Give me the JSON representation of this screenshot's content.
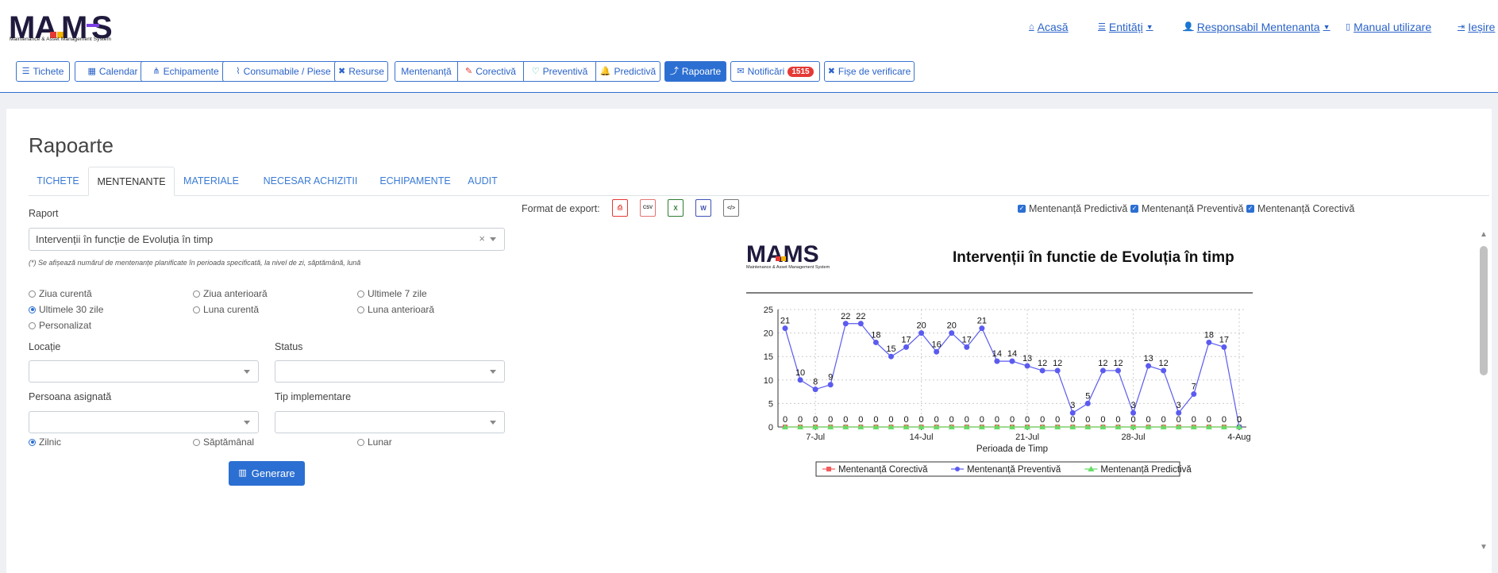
{
  "brand": {
    "logo_text": "MAMS",
    "subtitle": "Maintenance & Asset Management System"
  },
  "topnav": {
    "home": "Acasă",
    "entities": "Entități",
    "user": "Responsabil Mentenanta",
    "manual": "Manual utilizare",
    "logout": "Ieșire"
  },
  "toolbar": {
    "tickets": "Tichete",
    "calendar": "Calendar",
    "equipment": "Echipamente",
    "consumables": "Consumabile / Piese",
    "resources": "Resurse",
    "maintenance": "Mentenanță",
    "corrective": "Corectivă",
    "preventive": "Preventivă",
    "predictive": "Predictivă",
    "reports": "Rapoarte",
    "notifications": "Notificări",
    "notifications_count": "1515",
    "checklists": "Fișe de verificare"
  },
  "page": {
    "title": "Rapoarte",
    "tabs": [
      "TICHETE",
      "MENTENANTE",
      "MATERIALE",
      "NECESAR ACHIZITII",
      "ECHIPAMENTE",
      "AUDIT"
    ],
    "active_tab": "MENTENANTE"
  },
  "form": {
    "report_label": "Raport",
    "report_value": "Intervenții în funcție de Evoluția în timp",
    "report_clear": "×",
    "note": "(*) Se afișează numărul de mentenanțe planificate în perioada specificată, la nivel de zi, săptămână, lună",
    "periods": [
      "Ziua curentă",
      "Ziua anterioară",
      "Ultimele 7 zile",
      "Ultimele 30 zile",
      "Luna curentă",
      "Luna anterioară",
      "Personalizat"
    ],
    "period_selected": "Ultimele 30 zile",
    "location_label": "Locație",
    "status_label": "Status",
    "assignee_label": "Persoana asignată",
    "impl_label": "Tip implementare",
    "granularity": [
      "Zilnic",
      "Săptămânal",
      "Lunar"
    ],
    "granularity_selected": "Zilnic",
    "generate": "Generare"
  },
  "export": {
    "label": "Format de export:",
    "formats": [
      "pdf-icon",
      "csv-icon",
      "excel-icon",
      "word-icon",
      "html-icon"
    ],
    "glyphs": [
      "⎙",
      "CSV",
      "X",
      "W",
      "</>"
    ]
  },
  "filters": [
    "Mentenanță Predictivă",
    "Mentenanță Preventivă",
    "Mentenanță Corectivă"
  ],
  "chart_data": {
    "type": "line",
    "title": "Intervenții în functie de Evoluția în timp",
    "xlabel": "Perioada de Timp",
    "ylabel": "",
    "ylim": [
      0,
      25
    ],
    "yticks": [
      0,
      5,
      10,
      15,
      20,
      25
    ],
    "x": [
      "5-Jul",
      "6-Jul",
      "7-Jul",
      "8-Jul",
      "9-Jul",
      "10-Jul",
      "11-Jul",
      "12-Jul",
      "13-Jul",
      "14-Jul",
      "15-Jul",
      "16-Jul",
      "17-Jul",
      "18-Jul",
      "19-Jul",
      "20-Jul",
      "21-Jul",
      "22-Jul",
      "23-Jul",
      "24-Jul",
      "25-Jul",
      "26-Jul",
      "27-Jul",
      "28-Jul",
      "29-Jul",
      "30-Jul",
      "31-Jul",
      "1-Aug",
      "2-Aug",
      "3-Aug",
      "4-Aug"
    ],
    "xtick_labels": [
      "7-Jul",
      "14-Jul",
      "21-Jul",
      "28-Jul",
      "4-Aug"
    ],
    "series": [
      {
        "name": "Mentenanță Corectivă",
        "color": "#f25c5c",
        "marker": "square",
        "values": [
          0,
          0,
          0,
          0,
          0,
          0,
          0,
          0,
          0,
          0,
          0,
          0,
          0,
          0,
          0,
          0,
          0,
          0,
          0,
          0,
          0,
          0,
          0,
          0,
          0,
          0,
          0,
          0,
          0,
          0,
          0
        ]
      },
      {
        "name": "Mentenanță Preventivă",
        "color": "#5b5bf0",
        "marker": "circle",
        "values": [
          21,
          10,
          8,
          9,
          22,
          22,
          18,
          15,
          17,
          20,
          16,
          20,
          17,
          21,
          14,
          14,
          13,
          12,
          12,
          3,
          5,
          12,
          12,
          3,
          13,
          12,
          3,
          7,
          18,
          17,
          0
        ]
      },
      {
        "name": "Mentenanță Predictivă",
        "color": "#66dd66",
        "marker": "triangle",
        "values": [
          0,
          0,
          0,
          0,
          0,
          0,
          0,
          0,
          0,
          0,
          0,
          0,
          0,
          0,
          0,
          0,
          0,
          0,
          0,
          0,
          0,
          0,
          0,
          0,
          0,
          0,
          0,
          0,
          0,
          0,
          0
        ]
      }
    ],
    "legend": "bottom",
    "grid": true
  }
}
